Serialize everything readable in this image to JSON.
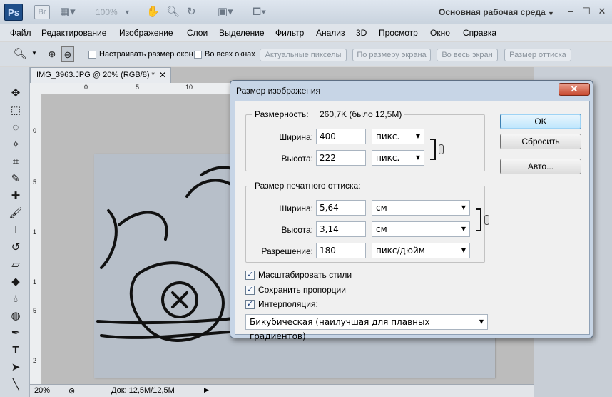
{
  "app": {
    "logo": "Ps",
    "bridge_logo": "Br",
    "zoom": "100%",
    "workspace": "Основная рабочая среда"
  },
  "menu": [
    "Файл",
    "Редактирование",
    "Изображение",
    "Слои",
    "Выделение",
    "Фильтр",
    "Анализ",
    "3D",
    "Просмотр",
    "Окно",
    "Справка"
  ],
  "options": {
    "fit_windows": "Настраивать размер окон",
    "all_windows": "Во всех окнах",
    "actual_pixels": "Актуальные пикселы",
    "fit_screen": "По размеру экрана",
    "fill_screen": "Во весь экран",
    "print_size": "Размер оттиска"
  },
  "document": {
    "tab_title": "IMG_3963.JPG @ 20% (RGB/8) *",
    "ruler_h": [
      "0",
      "5",
      "10"
    ],
    "ruler_v": [
      "0",
      "5",
      "1",
      "1",
      "5",
      "2"
    ],
    "zoom": "20%",
    "doc_info": "Док: 12,5M/12,5M"
  },
  "dialog": {
    "title": "Размер изображения",
    "pixel_group": {
      "label": "Размерность:",
      "size": "260,7K (было 12,5M)",
      "width_label": "Ширина:",
      "width_value": "400",
      "width_unit": "пикс.",
      "height_label": "Высота:",
      "height_value": "222",
      "height_unit": "пикс."
    },
    "print_group": {
      "label": "Размер печатного оттиска:",
      "width_label": "Ширина:",
      "width_value": "5,64",
      "width_unit": "см",
      "height_label": "Высота:",
      "height_value": "3,14",
      "height_unit": "см",
      "resolution_label": "Разрешение:",
      "resolution_value": "180",
      "resolution_unit": "пикс/дюйм"
    },
    "scale_styles": "Масштабировать стили",
    "constrain": "Сохранить пропорции",
    "resample": "Интерполяция:",
    "resample_method": "Бикубическая (наилучшая для плавных градиентов)",
    "ok": "OK",
    "reset": "Сбросить",
    "auto": "Авто..."
  }
}
